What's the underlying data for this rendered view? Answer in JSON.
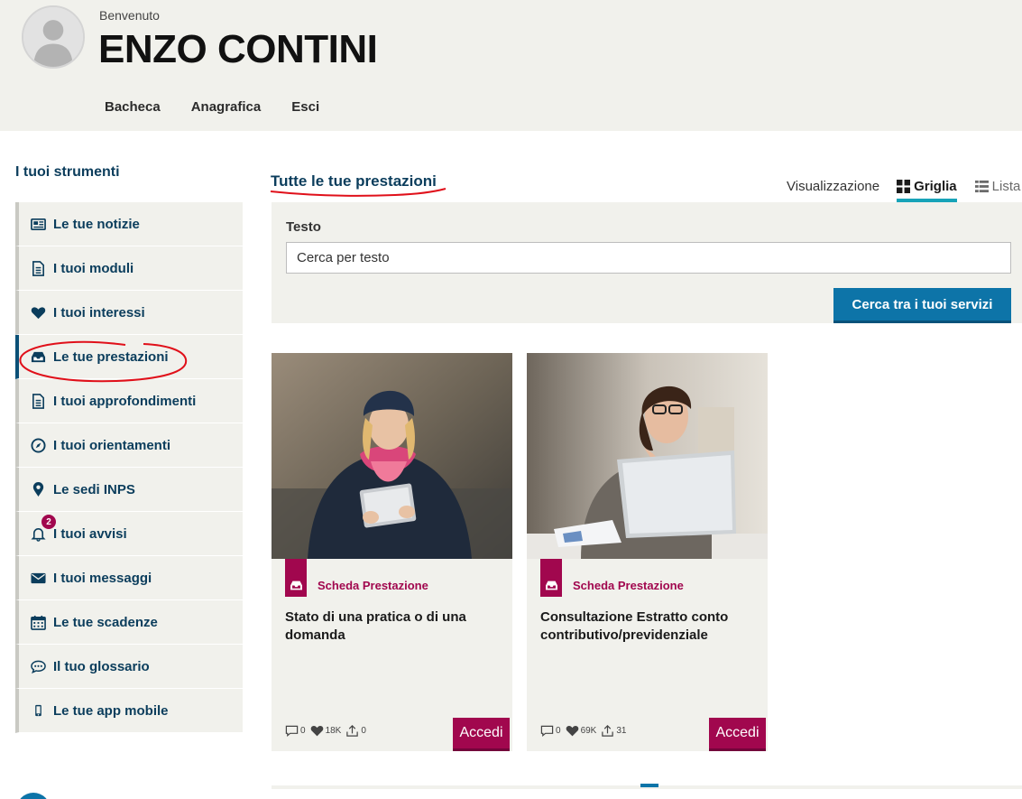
{
  "header": {
    "welcome": "Benvenuto",
    "user_name": "ENZO CONTINI",
    "nav": [
      "Bacheca",
      "Anagrafica",
      "Esci"
    ]
  },
  "sidebar": {
    "title": "I tuoi strumenti",
    "items": [
      {
        "label": "Le tue notizie",
        "icon": "newspaper-icon"
      },
      {
        "label": "I tuoi moduli",
        "icon": "document-icon"
      },
      {
        "label": "I tuoi interessi",
        "icon": "heart-icon"
      },
      {
        "label": "Le tue prestazioni",
        "icon": "inbox-icon",
        "active": true
      },
      {
        "label": "I tuoi approfondimenti",
        "icon": "document-icon"
      },
      {
        "label": "I tuoi orientamenti",
        "icon": "compass-icon"
      },
      {
        "label": "Le sedi INPS",
        "icon": "map-pin-icon"
      },
      {
        "label": "I tuoi avvisi",
        "icon": "bell-icon",
        "badge": "2"
      },
      {
        "label": "I tuoi messaggi",
        "icon": "envelope-icon"
      },
      {
        "label": "Le tue scadenze",
        "icon": "calendar-icon"
      },
      {
        "label": "Il tuo glossario",
        "icon": "chat-bubble-icon"
      },
      {
        "label": "Le tue app mobile",
        "icon": "mobile-icon"
      }
    ]
  },
  "main": {
    "title": "Tutte le tue prestazioni",
    "view": {
      "label": "Visualizzazione",
      "grid": "Griglia",
      "list": "Lista",
      "selected": "Griglia"
    },
    "search": {
      "label": "Testo",
      "placeholder": "Cerca per testo",
      "button": "Cerca tra i tuoi servizi"
    },
    "cards": [
      {
        "type": "Scheda Prestazione",
        "title": "Stato di una pratica o di una domanda",
        "comments": "0",
        "likes": "18K",
        "shares": "0",
        "button": "Accedi"
      },
      {
        "type": "Scheda Prestazione",
        "title": "Consultazione Estratto conto contributivo/previdenziale",
        "comments": "0",
        "likes": "69K",
        "shares": "31",
        "button": "Accedi"
      }
    ]
  },
  "colors": {
    "brand_blue": "#0b3d5c",
    "button_blue": "#0d74a8",
    "accent_magenta": "#a1074e",
    "panel_bg": "#f1f1ec",
    "annotation_red": "#e0101a"
  }
}
